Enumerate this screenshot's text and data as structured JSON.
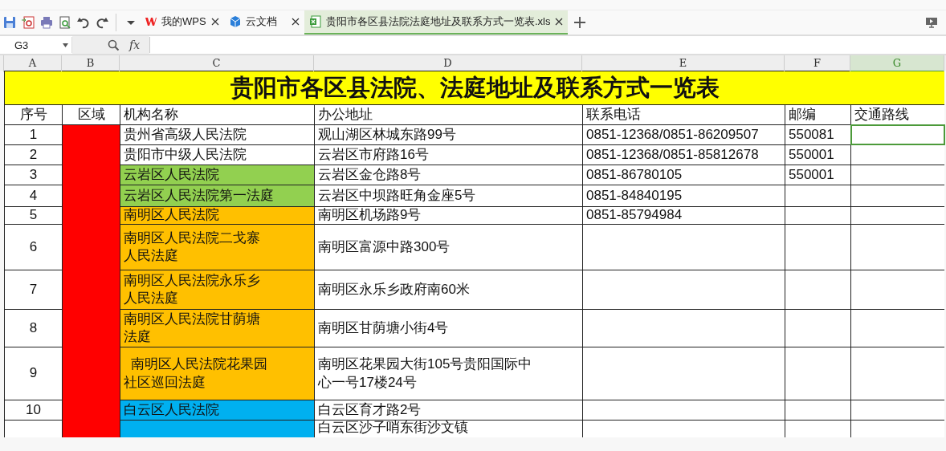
{
  "toolbar": {
    "tabs": [
      {
        "label": "我的WPS",
        "kind": "wps",
        "selected": false
      },
      {
        "label": "云文档",
        "kind": "cloud",
        "selected": false
      },
      {
        "label": "贵阳市各区县法院法庭地址及联系方式一览表.xls",
        "kind": "sheet",
        "selected": true
      }
    ]
  },
  "formula_bar": {
    "name_box": "G3",
    "fx": "fx"
  },
  "columns": [
    {
      "label": "A",
      "selected": false
    },
    {
      "label": "B",
      "selected": false
    },
    {
      "label": "C",
      "selected": false
    },
    {
      "label": "D",
      "selected": false
    },
    {
      "label": "E",
      "selected": false
    },
    {
      "label": "F",
      "selected": false
    },
    {
      "label": "G",
      "selected": true
    }
  ],
  "sheet": {
    "title": "贵阳市各区县法院、法庭地址及联系方式一览表",
    "headers": [
      "序号",
      "区域",
      "机构名称",
      "办公地址",
      "联系电话",
      "邮编",
      "交通路线"
    ],
    "rows": [
      {
        "no": "1",
        "court": "贵州省高级人民法院",
        "color": "#ffffff",
        "address": "观山湖区林城东路99号",
        "phone": "0851-12368/0851-86209507",
        "postcode": "550081",
        "selected": true
      },
      {
        "no": "2",
        "court": "贵阳市中级人民法院",
        "color": "#ffffff",
        "address": "云岩区市府路16号",
        "phone": "0851-12368/0851-85812678",
        "postcode": "550001",
        "selected": false
      },
      {
        "no": "3",
        "court": "云岩区人民法院",
        "color": "#92d050",
        "address": "云岩区金仓路8号",
        "phone": "0851-86780105",
        "postcode": "550001",
        "selected": false
      },
      {
        "no": "4",
        "court": "云岩区人民法院第一法庭",
        "color": "#92d050",
        "address": "云岩区中坝路旺角金座5号",
        "phone": "0851-84840195",
        "selected": false
      },
      {
        "no": "5",
        "court": "南明区人民法院",
        "color": "#ffc000",
        "address": "南明区机场路9号",
        "phone": "0851-85794984",
        "selected": false
      },
      {
        "no": "6",
        "court": "南明区人民法院二戈寨人民法庭",
        "color": "#ffc000",
        "address": "南明区富源中路300号",
        "selected": false
      },
      {
        "no": "7",
        "court": "南明区人民法院永乐乡人民法庭",
        "color": "#ffc000",
        "address": "南明区永乐乡政府南60米",
        "selected": false
      },
      {
        "no": "8",
        "court": "南明区人民法院甘荫塘法庭",
        "color": "#ffc000",
        "address": "南明区甘荫塘小街4号",
        "selected": false
      },
      {
        "no": "9",
        "court": "  南明区人民法院花果园社区巡回法庭",
        "color": "#ffc000",
        "address": "南明区花果园大街105号贵阳国际中心一号17楼24号",
        "selected": false
      },
      {
        "no": "10",
        "court": "白云区人民法院",
        "color": "#00b0f0",
        "address": "白云区育才路2号",
        "selected": false
      },
      {
        "color": "#00b0f0",
        "address": "白云区沙子哨东街沙文镇",
        "selected": false
      }
    ]
  }
}
